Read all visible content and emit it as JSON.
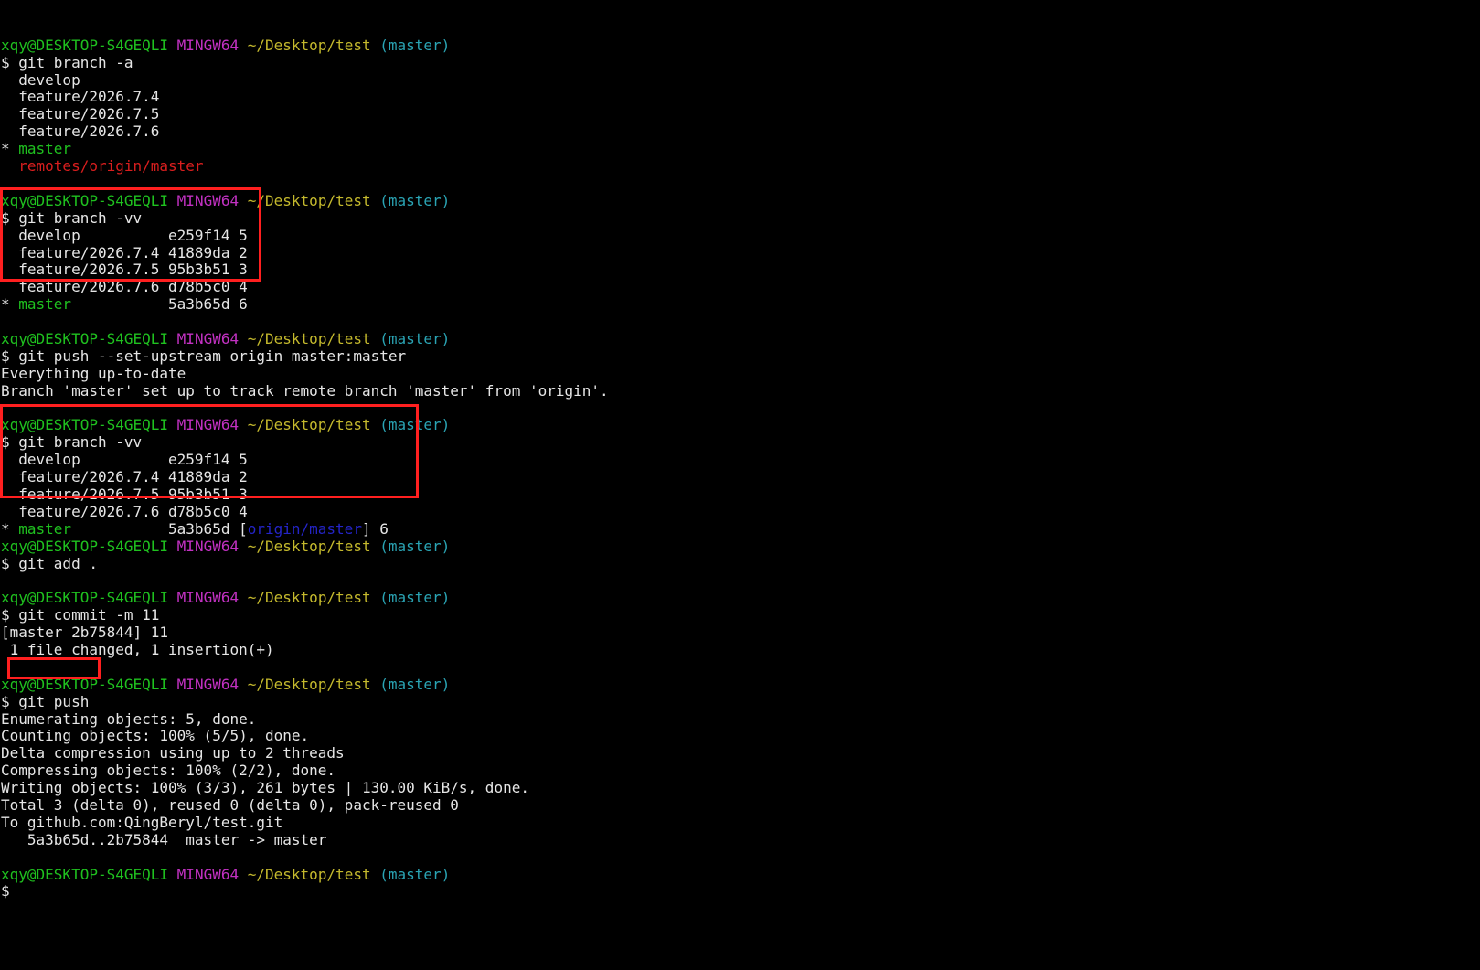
{
  "terminal": {
    "colors": {
      "background": "#000000",
      "text": "#e6e6e6",
      "prompt_user": "#1fc11f",
      "prompt_env": "#c231c2",
      "prompt_path": "#c4b92d",
      "prompt_branch": "#2aa4b4",
      "remote_branch": "#d91e1e",
      "upstream": "#2424c8",
      "highlight_box": "#ff1f1f"
    },
    "lines": [
      [
        {
          "t": "xqy@DESKTOP-S4GEQLI",
          "c": "green"
        },
        {
          "t": " "
        },
        {
          "t": "MINGW64",
          "c": "magenta"
        },
        {
          "t": " "
        },
        {
          "t": "~/Desktop/test",
          "c": "yellow"
        },
        {
          "t": " "
        },
        {
          "t": "(master)",
          "c": "cyan"
        }
      ],
      [
        {
          "t": "$ git branch -a"
        }
      ],
      [
        {
          "t": "  develop"
        }
      ],
      [
        {
          "t": "  feature/2026.7.4"
        }
      ],
      [
        {
          "t": "  feature/2026.7.5"
        }
      ],
      [
        {
          "t": "  feature/2026.7.6"
        }
      ],
      [
        {
          "t": "* "
        },
        {
          "t": "master",
          "c": "green"
        }
      ],
      [
        {
          "t": "  "
        },
        {
          "t": "remotes/origin/master",
          "c": "red"
        }
      ],
      [
        {
          "t": ""
        }
      ],
      [
        {
          "t": "xqy@DESKTOP-S4GEQLI",
          "c": "green"
        },
        {
          "t": " "
        },
        {
          "t": "MINGW64",
          "c": "magenta"
        },
        {
          "t": " "
        },
        {
          "t": "~/Desktop/test",
          "c": "yellow"
        },
        {
          "t": " "
        },
        {
          "t": "(master)",
          "c": "cyan"
        }
      ],
      [
        {
          "t": "$ git branch -vv"
        }
      ],
      [
        {
          "t": "  develop          e259f14 5"
        }
      ],
      [
        {
          "t": "  feature/2026.7.4 41889da 2"
        }
      ],
      [
        {
          "t": "  feature/2026.7.5 95b3b51 3"
        }
      ],
      [
        {
          "t": "  feature/2026.7.6 d78b5c0 4"
        }
      ],
      [
        {
          "t": "* "
        },
        {
          "t": "master",
          "c": "green"
        },
        {
          "t": "           5a3b65d 6"
        }
      ],
      [
        {
          "t": ""
        }
      ],
      [
        {
          "t": "xqy@DESKTOP-S4GEQLI",
          "c": "green"
        },
        {
          "t": " "
        },
        {
          "t": "MINGW64",
          "c": "magenta"
        },
        {
          "t": " "
        },
        {
          "t": "~/Desktop/test",
          "c": "yellow"
        },
        {
          "t": " "
        },
        {
          "t": "(master)",
          "c": "cyan"
        }
      ],
      [
        {
          "t": "$ git push --set-upstream origin master:master"
        }
      ],
      [
        {
          "t": "Everything up-to-date"
        }
      ],
      [
        {
          "t": "Branch 'master' set up to track remote branch 'master' from 'origin'."
        }
      ],
      [
        {
          "t": ""
        }
      ],
      [
        {
          "t": "xqy@DESKTOP-S4GEQLI",
          "c": "green"
        },
        {
          "t": " "
        },
        {
          "t": "MINGW64",
          "c": "magenta"
        },
        {
          "t": " "
        },
        {
          "t": "~/Desktop/test",
          "c": "yellow"
        },
        {
          "t": " "
        },
        {
          "t": "(master)",
          "c": "cyan"
        }
      ],
      [
        {
          "t": "$ git branch -vv"
        }
      ],
      [
        {
          "t": "  develop          e259f14 5"
        }
      ],
      [
        {
          "t": "  feature/2026.7.4 41889da 2"
        }
      ],
      [
        {
          "t": "  feature/2026.7.5 95b3b51 3"
        }
      ],
      [
        {
          "t": "  feature/2026.7.6 d78b5c0 4"
        }
      ],
      [
        {
          "t": "* "
        },
        {
          "t": "master",
          "c": "green"
        },
        {
          "t": "           5a3b65d ["
        },
        {
          "t": "origin/master",
          "c": "blue"
        },
        {
          "t": "] 6"
        }
      ],
      [
        {
          "t": "xqy@DESKTOP-S4GEQLI",
          "c": "green"
        },
        {
          "t": " "
        },
        {
          "t": "MINGW64",
          "c": "magenta"
        },
        {
          "t": " "
        },
        {
          "t": "~/Desktop/test",
          "c": "yellow"
        },
        {
          "t": " "
        },
        {
          "t": "(master)",
          "c": "cyan"
        }
      ],
      [
        {
          "t": "$ git add ."
        }
      ],
      [
        {
          "t": ""
        }
      ],
      [
        {
          "t": "xqy@DESKTOP-S4GEQLI",
          "c": "green"
        },
        {
          "t": " "
        },
        {
          "t": "MINGW64",
          "c": "magenta"
        },
        {
          "t": " "
        },
        {
          "t": "~/Desktop/test",
          "c": "yellow"
        },
        {
          "t": " "
        },
        {
          "t": "(master)",
          "c": "cyan"
        }
      ],
      [
        {
          "t": "$ git commit -m 11"
        }
      ],
      [
        {
          "t": "[master 2b75844] 11"
        }
      ],
      [
        {
          "t": " 1 file changed, 1 insertion(+)"
        }
      ],
      [
        {
          "t": ""
        }
      ],
      [
        {
          "t": "xqy@DESKTOP-S4GEQLI",
          "c": "green"
        },
        {
          "t": " "
        },
        {
          "t": "MINGW64",
          "c": "magenta"
        },
        {
          "t": " "
        },
        {
          "t": "~/Desktop/test",
          "c": "yellow"
        },
        {
          "t": " "
        },
        {
          "t": "(master)",
          "c": "cyan"
        }
      ],
      [
        {
          "t": "$ git push"
        }
      ],
      [
        {
          "t": "Enumerating objects: 5, done."
        }
      ],
      [
        {
          "t": "Counting objects: 100% (5/5), done."
        }
      ],
      [
        {
          "t": "Delta compression using up to 2 threads"
        }
      ],
      [
        {
          "t": "Compressing objects: 100% (2/2), done."
        }
      ],
      [
        {
          "t": "Writing objects: 100% (3/3), 261 bytes | 130.00 KiB/s, done."
        }
      ],
      [
        {
          "t": "Total 3 (delta 0), reused 0 (delta 0), pack-reused 0"
        }
      ],
      [
        {
          "t": "To github.com:QingBeryl/test.git"
        }
      ],
      [
        {
          "t": "   5a3b65d..2b75844  master -> master"
        }
      ],
      [
        {
          "t": ""
        }
      ],
      [
        {
          "t": "xqy@DESKTOP-S4GEQLI",
          "c": "green"
        },
        {
          "t": " "
        },
        {
          "t": "MINGW64",
          "c": "magenta"
        },
        {
          "t": " "
        },
        {
          "t": "~/Desktop/test",
          "c": "yellow"
        },
        {
          "t": " "
        },
        {
          "t": "(master)",
          "c": "cyan"
        }
      ],
      [
        {
          "t": "$"
        }
      ]
    ]
  }
}
